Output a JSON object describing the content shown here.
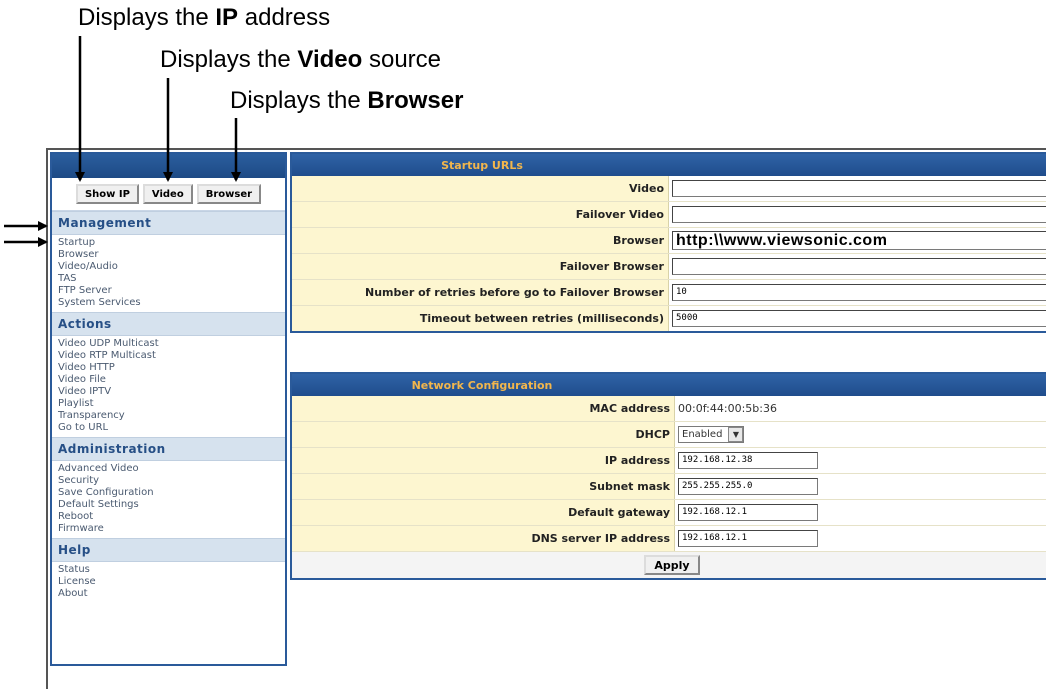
{
  "callouts": {
    "ip": {
      "prefix": "Displays the ",
      "bold": "IP",
      "suffix": " address"
    },
    "video": {
      "prefix": "Displays the ",
      "bold": "Video",
      "suffix": " source"
    },
    "browser": {
      "prefix": "Displays the ",
      "bold": "Browser",
      "suffix": ""
    }
  },
  "sidebar": {
    "buttons": {
      "show_ip": "Show IP",
      "video": "Video",
      "browser": "Browser"
    },
    "sections": [
      {
        "title": "Management",
        "items": [
          "Startup",
          "Browser",
          "Video/Audio",
          "TAS",
          "FTP Server",
          "System Services"
        ]
      },
      {
        "title": "Actions",
        "items": [
          "Video UDP Multicast",
          "Video RTP Multicast",
          "Video HTTP",
          "Video File",
          "Video IPTV",
          "Playlist",
          "Transparency",
          "Go to URL"
        ]
      },
      {
        "title": "Administration",
        "items": [
          "Advanced Video",
          "Security",
          "Save Configuration",
          "Default Settings",
          "Reboot",
          "Firmware"
        ]
      },
      {
        "title": "Help",
        "items": [
          "Status",
          "License",
          "About"
        ]
      }
    ]
  },
  "startup": {
    "title": "Startup URLs",
    "video_label": "Video",
    "video_value": "",
    "failover_video_label": "Failover Video",
    "failover_video_value": "",
    "browser_label": "Browser",
    "browser_value": "http:\\\\www.viewsonic.com",
    "failover_browser_label": "Failover Browser",
    "failover_browser_value": "",
    "retries_label": "Number of retries before go to Failover Browser",
    "retries_value": "10",
    "timeout_label": "Timeout between retries (milliseconds)",
    "timeout_value": "5000"
  },
  "network": {
    "title": "Network Configuration",
    "mac_label": "MAC address",
    "mac_value": "00:0f:44:00:5b:36",
    "dhcp_label": "DHCP",
    "dhcp_value": "Enabled",
    "ip_label": "IP address",
    "ip_value": "192.168.12.38",
    "subnet_label": "Subnet mask",
    "subnet_value": "255.255.255.0",
    "gateway_label": "Default gateway",
    "gateway_value": "192.168.12.1",
    "dns_label": "DNS server IP address",
    "dns_value": "192.168.12.1",
    "apply_label": "Apply"
  },
  "colors": {
    "header_blue": "#1f4d8c",
    "header_text": "#f2b64c",
    "label_bg": "#fdf6d0",
    "section_bg": "#d6e2ee"
  }
}
